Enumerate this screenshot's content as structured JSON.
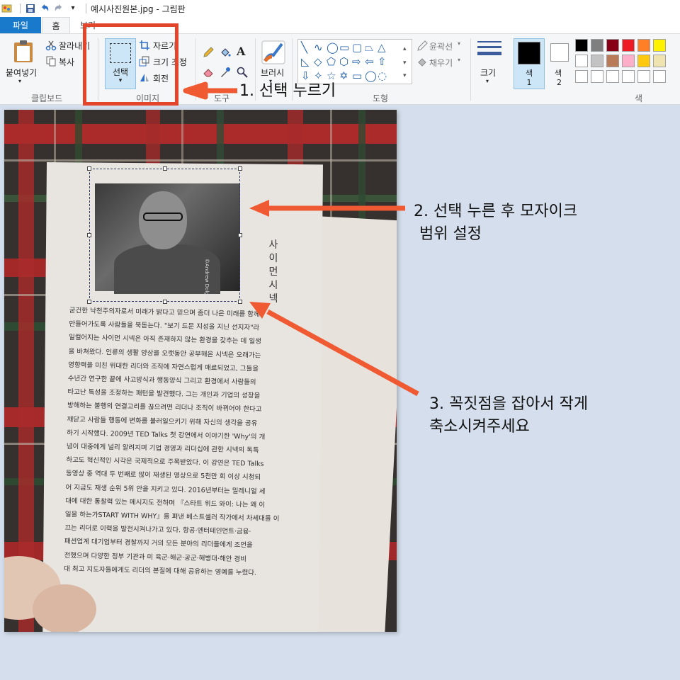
{
  "titlebar": {
    "title": "예시사진원본.jpg - 그림판"
  },
  "tabs": {
    "file": "파일",
    "home": "홈",
    "view": "보기"
  },
  "ribbon": {
    "clipboard": {
      "paste": "붙여넣기",
      "cut": "잘라내기",
      "copy": "복사",
      "group": "클립보드"
    },
    "image": {
      "select": "선택",
      "crop": "자르기",
      "resize": "크기 조정",
      "rotate": "회전",
      "group": "이미지"
    },
    "tools": {
      "group": "도구"
    },
    "brushes": {
      "label": "브러시"
    },
    "shapes": {
      "outline": "윤곽선",
      "fill": "채우기",
      "group": "도형"
    },
    "size": {
      "label": "크기"
    },
    "colors": {
      "color1": "색",
      "color1_num": "1",
      "color2": "색",
      "color2_num": "2",
      "group": "색"
    },
    "palette": [
      "#000000",
      "#7f7f7f",
      "#880015",
      "#ed1c24",
      "#ff7f27",
      "#fff200",
      "#ffffff",
      "#c3c3c3",
      "#b97a57",
      "#ffaec9",
      "#ffc90e",
      "#efe4b0",
      "#ffffff",
      "#ffffff",
      "#ffffff",
      "#ffffff",
      "#ffffff",
      "#ffffff"
    ]
  },
  "book": {
    "vertical_title": "사이먼시넥",
    "photo_credit": "©Andrew Dolgin",
    "lines": [
      "굳건한 낙천주의자로서 미래가 밝다고 믿으며 좀더 나은 미래를 함께",
      "만들어가도록 사람들을 북돋는다. \"보기 드문 지성을 지닌 선지자\"라",
      "일컬어지는 사이먼 시넥은 아직 존재하지 않는 환경을 갖추는 데 일생",
      "을 바쳐왔다. 인류의 생활 양상을 오랫동안 공부해온 시넥은 오래가는",
      "영향력을 미친 위대한 리더와 조직에 자연스럽게 매료되었고, 그들을",
      "수년간 연구한 끝에 사고방식과 행동양식 그리고 환경에서 사람들의",
      "타고난 특성을 조정하는 패턴을 발견했다. 그는 개인과 기업의 성장을",
      "방해하는 불행의 연결고리를 끊으려면 리더나 조직이 바뀌어야 한다고",
      "깨닫고 사람들 행동에 변화를 불러일으키기 위해 자신의 생각을 공유",
      "하기 시작했다. 2009년 TED Talks 첫 강연에서 이야기한 'Why'의 개",
      "념이 대중에게 널리 알려지며 기업 경영과 리더십에 관한 시넥의 독특",
      "하고도 혁신적인 시각은 국제적으로 주목받았다. 이 강연은 TED Talks",
      "동영상 중 역대 두 번째로 많이 재생된 영상으로 5천만 회 이상 시청되",
      "어 지금도 재생 순위 5위 안을 지키고 있다. 2016년부터는 밀레니얼 세",
      "대에 대한 통찰력 있는 메시지도 전하며 『스타트 위드 와이: 나는 왜 이",
      "일을 하는가START WITH WHY』를 펴낸 베스트셀러 작가에서 차세대를 이",
      "끄는 리더로 이력을 발전시켜나가고 있다. 항공·엔터테인먼트·금융·",
      "패션업계 대기업부터 경찰까지 거의 모든 분야의 리더들에게 조언을",
      "전했으며 다양한 정부 기관과 미 육군·해군·공군·해병대·해안 경비",
      "대 최고 지도자들에게도 리더의 본질에 대해 공유하는 영예를 누렸다."
    ]
  },
  "annotations": {
    "step1": "1. 선택 누르기",
    "step2_line1": "2. 선택 누른 후 모자이크",
    "step2_line2": "범위 설정",
    "step3_line1": "3. 꼭짓점을 잡아서 작게",
    "step3_line2": "축소시켜주세요"
  },
  "colors": {
    "accent": "#1979ca",
    "highlight": "#e2452a",
    "arrow": "#f05a32"
  }
}
